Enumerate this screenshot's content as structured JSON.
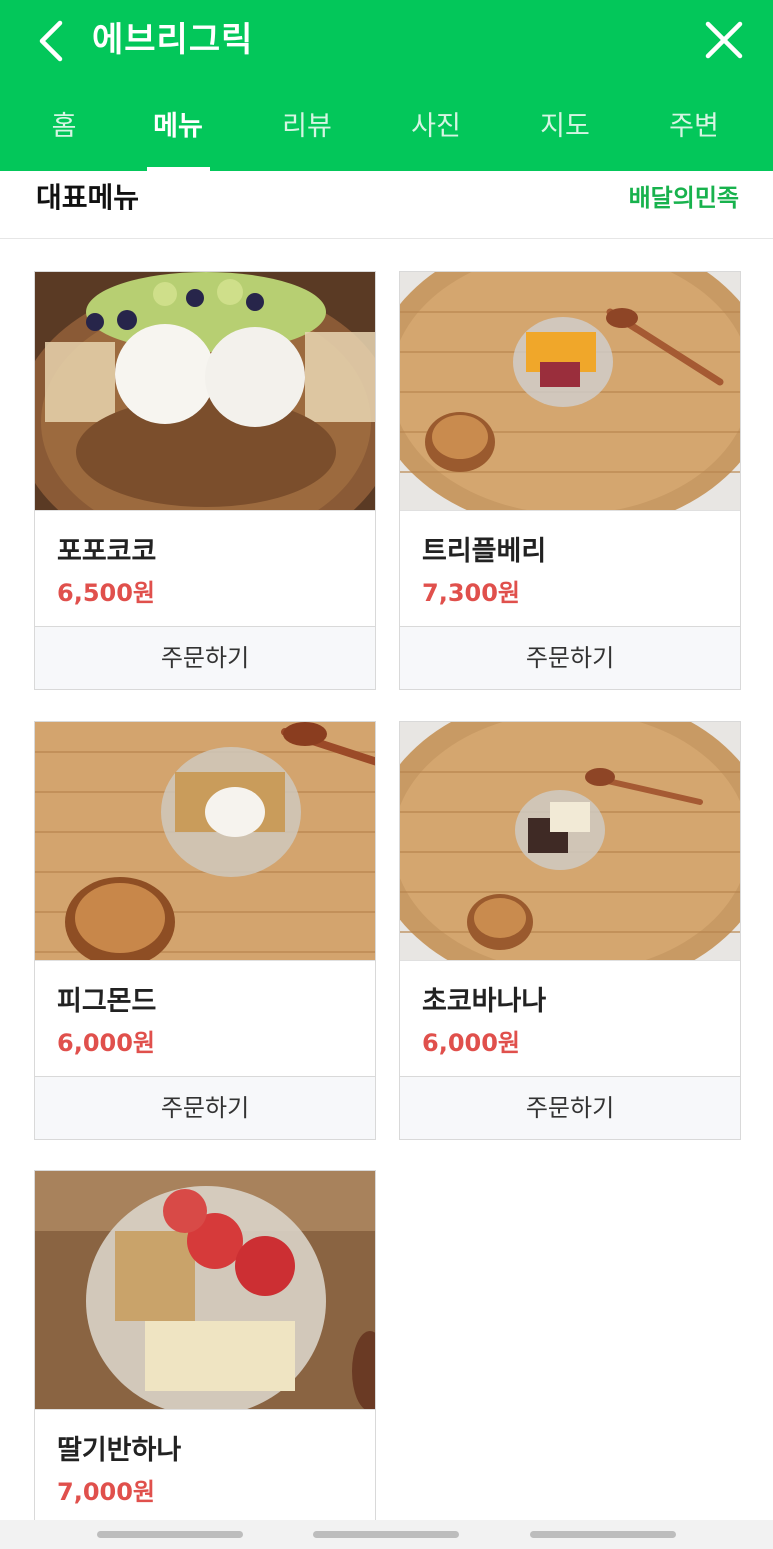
{
  "header": {
    "title": "에브리그릭"
  },
  "tabs": [
    {
      "label": "홈",
      "active": false
    },
    {
      "label": "메뉴",
      "active": true
    },
    {
      "label": "리뷰",
      "active": false
    },
    {
      "label": "사진",
      "active": false
    },
    {
      "label": "지도",
      "active": false
    },
    {
      "label": "주변",
      "active": false
    }
  ],
  "section": {
    "title": "대표메뉴",
    "link": "배달의민족"
  },
  "menu": [
    {
      "name": "포포코코",
      "price": "6,500원",
      "order": "주문하기"
    },
    {
      "name": "트리플베리",
      "price": "7,300원",
      "order": "주문하기"
    },
    {
      "name": "피그몬드",
      "price": "6,000원",
      "order": "주문하기"
    },
    {
      "name": "초코바나나",
      "price": "6,000원",
      "order": "주문하기"
    },
    {
      "name": "딸기반하나",
      "price": "7,000원"
    }
  ],
  "colors": {
    "brand": "#03c75a",
    "price": "#e0504c",
    "link": "#18b24d"
  }
}
